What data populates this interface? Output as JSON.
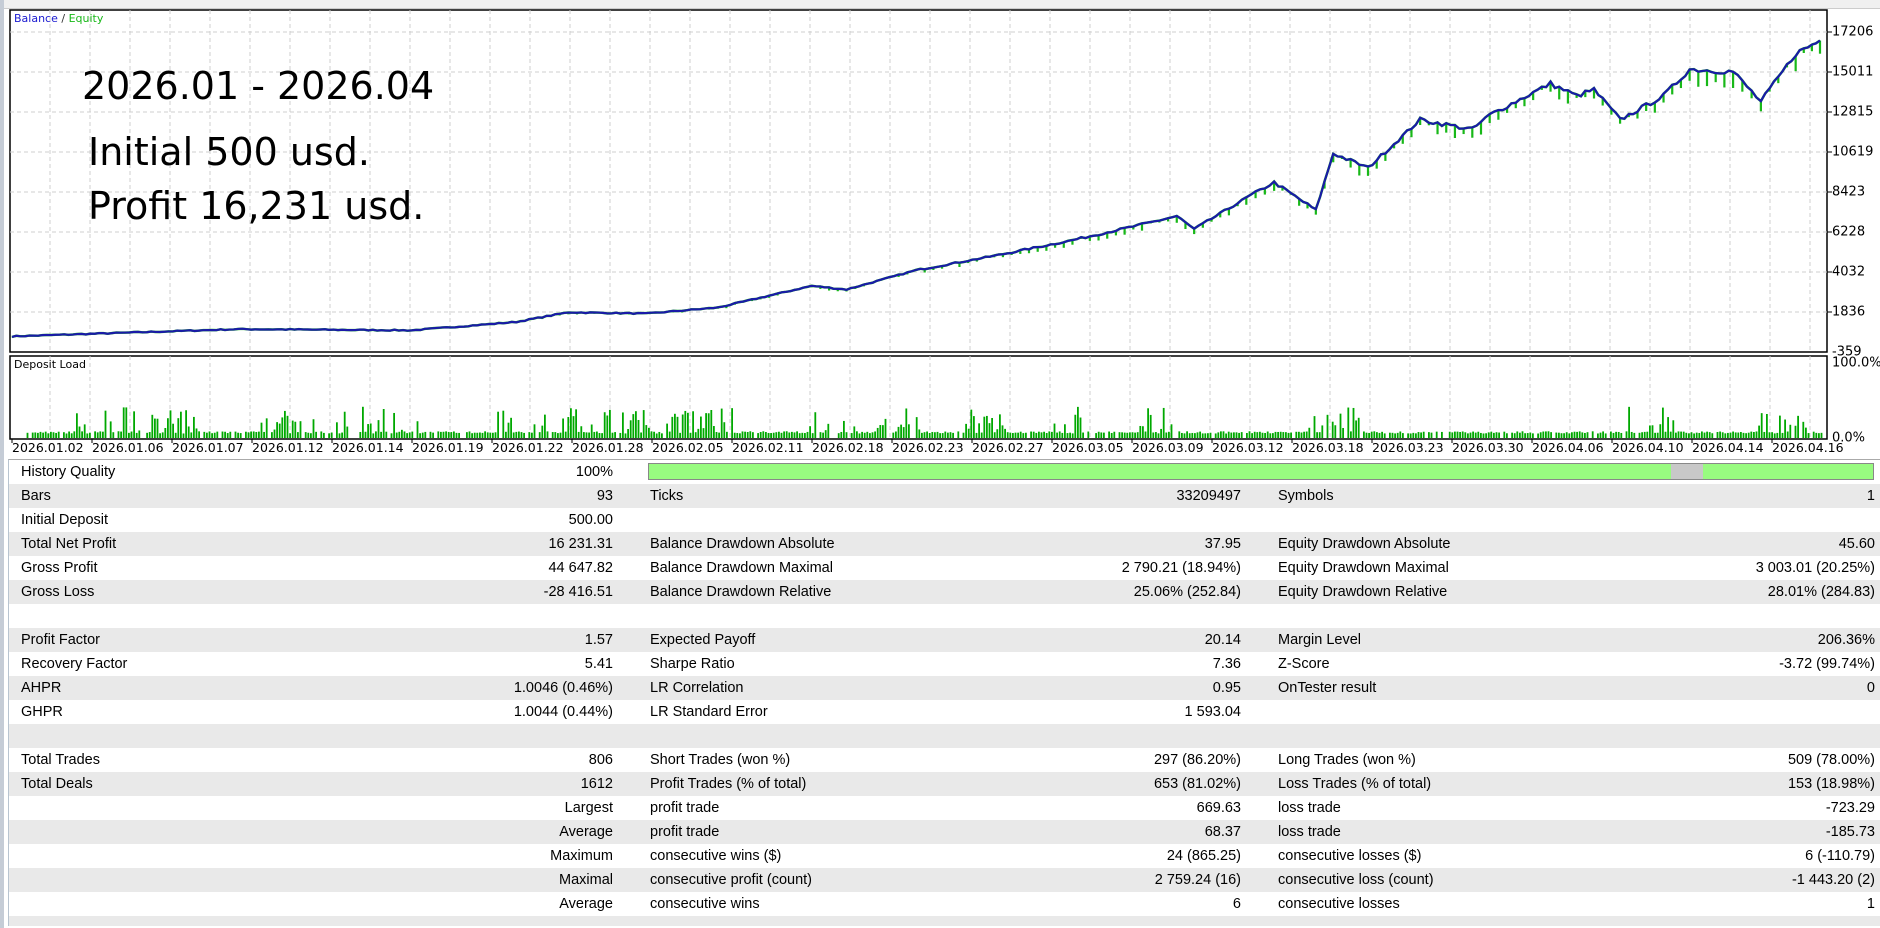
{
  "chart": {
    "legend_balance": "Balance",
    "legend_sep": "/",
    "legend_equity": "Equity",
    "annotations": [
      "2026.01 - 2026.04",
      "Initial 500 usd.",
      "Profit 16,231 usd."
    ],
    "y_ticks": [
      "17206",
      "15011",
      "12815",
      "10619",
      "8423",
      "6228",
      "4032",
      "1836",
      "-359"
    ],
    "y_range": [
      -359,
      17206
    ],
    "deposit_load_label": "Deposit Load",
    "deposit_ticks": [
      "100.0%",
      "0.0%"
    ],
    "x_labels": [
      "2026.01.02",
      "2026.01.06",
      "2026.01.07",
      "2026.01.12",
      "2026.01.14",
      "2026.01.19",
      "2026.01.22",
      "2026.01.28",
      "2026.02.05",
      "2026.02.11",
      "2026.02.18",
      "2026.02.23",
      "2026.02.27",
      "2026.03.05",
      "2026.03.09",
      "2026.03.12",
      "2026.03.18",
      "2026.03.23",
      "2026.03.30",
      "2026.04.06",
      "2026.04.10",
      "2026.04.14",
      "2026.04.16"
    ],
    "colors": {
      "balance": "#1a1aa8",
      "equity": "#18b818",
      "deposit": "#00a800"
    }
  },
  "chart_data": {
    "type": "line",
    "title": "Balance / Equity",
    "x_unit": "days since 2026.01.02",
    "series": [
      {
        "name": "Balance",
        "points": [
          [
            0,
            500
          ],
          [
            13,
            896
          ],
          [
            23,
            830
          ],
          [
            29,
            1290
          ],
          [
            32,
            1820
          ],
          [
            36.5,
            1750
          ],
          [
            40.6,
            2080
          ],
          [
            46,
            3270
          ],
          [
            48,
            3070
          ],
          [
            52,
            4130
          ],
          [
            56.5,
            4920
          ],
          [
            61,
            5780
          ],
          [
            65,
            6640
          ],
          [
            67,
            7100
          ],
          [
            68,
            6380
          ],
          [
            71,
            8100
          ],
          [
            72.6,
            8950
          ],
          [
            75,
            7430
          ],
          [
            76,
            10540
          ],
          [
            78,
            9750
          ],
          [
            81,
            12390
          ],
          [
            84,
            11860
          ],
          [
            85,
            12650
          ],
          [
            88.5,
            14370
          ],
          [
            90,
            13700
          ],
          [
            91,
            14040
          ],
          [
            92.5,
            12390
          ],
          [
            95,
            13700
          ],
          [
            96.5,
            15160
          ],
          [
            99,
            15030
          ],
          [
            100.6,
            13380
          ],
          [
            102.6,
            16020
          ],
          [
            104,
            16740
          ]
        ]
      }
    ],
    "ylim": [
      -359,
      17206
    ]
  },
  "stats": {
    "quality_pct": 100,
    "rows": [
      [
        "History Quality",
        "100%",
        "",
        "",
        "",
        ""
      ],
      [
        "Bars",
        "93",
        "Ticks",
        "33209497",
        "Symbols",
        "1"
      ],
      [
        "Initial Deposit",
        "500.00",
        "",
        "",
        "",
        ""
      ],
      [
        "Total Net Profit",
        "16 231.31",
        "Balance Drawdown Absolute",
        "37.95",
        "Equity Drawdown Absolute",
        "45.60"
      ],
      [
        "Gross Profit",
        "44 647.82",
        "Balance Drawdown Maximal",
        "2 790.21 (18.94%)",
        "Equity Drawdown Maximal",
        "3 003.01 (20.25%)"
      ],
      [
        "Gross Loss",
        "-28 416.51",
        "Balance Drawdown Relative",
        "25.06% (252.84)",
        "Equity Drawdown Relative",
        "28.01% (284.83)"
      ],
      [
        "",
        "",
        "",
        "",
        "",
        ""
      ],
      [
        "Profit Factor",
        "1.57",
        "Expected Payoff",
        "20.14",
        "Margin Level",
        "206.36%"
      ],
      [
        "Recovery Factor",
        "5.41",
        "Sharpe Ratio",
        "7.36",
        "Z-Score",
        "-3.72 (99.74%)"
      ],
      [
        "AHPR",
        "1.0046 (0.46%)",
        "LR Correlation",
        "0.95",
        "OnTester result",
        "0"
      ],
      [
        "GHPR",
        "1.0044 (0.44%)",
        "LR Standard Error",
        "1 593.04",
        "",
        ""
      ],
      [
        "",
        "",
        "",
        "",
        "",
        ""
      ],
      [
        "Total Trades",
        "806",
        "Short Trades (won %)",
        "297 (86.20%)",
        "Long Trades (won %)",
        "509 (78.00%)"
      ],
      [
        "Total Deals",
        "1612",
        "Profit Trades (% of total)",
        "653 (81.02%)",
        "Loss Trades (% of total)",
        "153 (18.98%)"
      ],
      [
        "",
        "Largest",
        "profit trade",
        "669.63",
        "loss trade",
        "-723.29"
      ],
      [
        "",
        "Average",
        "profit trade",
        "68.37",
        "loss trade",
        "-185.73"
      ],
      [
        "",
        "Maximum",
        "consecutive wins ($)",
        "24 (865.25)",
        "consecutive losses ($)",
        "6 (-110.79)"
      ],
      [
        "",
        "Maximal",
        "consecutive profit (count)",
        "2 759.24 (16)",
        "consecutive loss (count)",
        "-1 443.20 (2)"
      ],
      [
        "",
        "Average",
        "consecutive wins",
        "6",
        "consecutive losses",
        "1"
      ]
    ]
  }
}
